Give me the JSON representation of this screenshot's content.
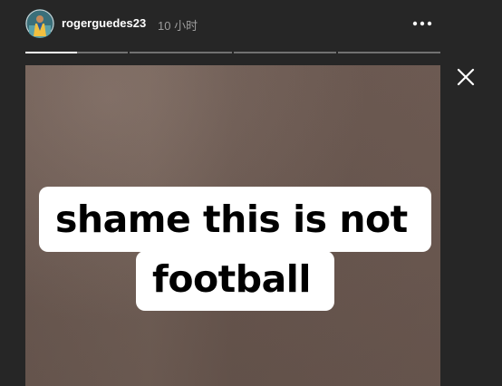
{
  "story": {
    "username": "rogerguedes23",
    "timestamp": "10 小时",
    "caption_line1": "shame this is not",
    "caption_line2": "football",
    "progress": {
      "segments": 4,
      "active_index": 0,
      "active_fill": 0.5
    }
  },
  "icons": {
    "more": "more-horizontal-icon",
    "close": "close-icon",
    "avatar": "profile-avatar"
  },
  "colors": {
    "background": "#262626",
    "text_primary": "#ffffff",
    "text_secondary": "#9c9c9c",
    "caption_bg": "#ffffff",
    "caption_text": "#000000"
  }
}
